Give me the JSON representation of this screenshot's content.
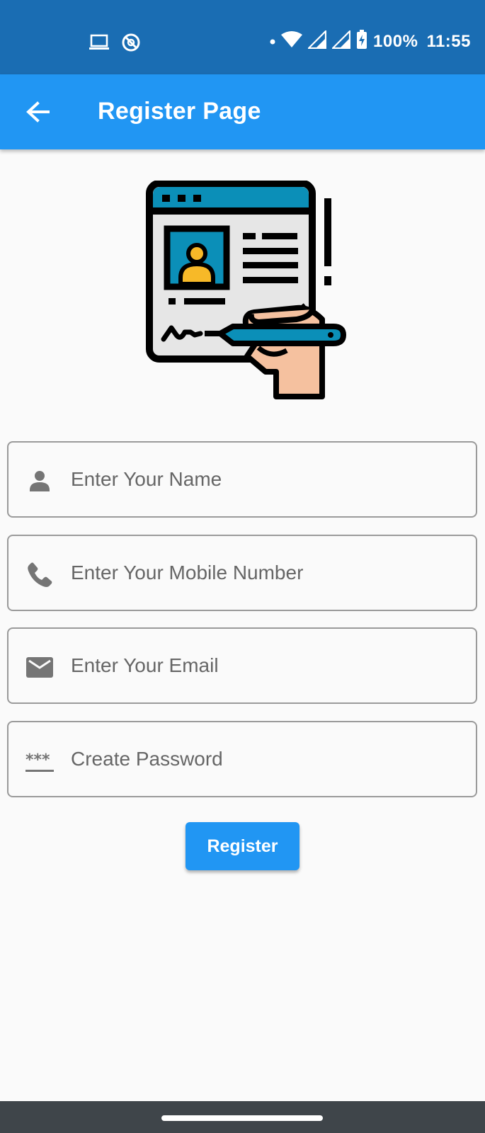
{
  "status_bar": {
    "battery": "100%",
    "time": "11:55",
    "icons": [
      "laptop-icon",
      "sync-off-icon",
      "dot-icon",
      "wifi-icon",
      "signal-icon",
      "signal-icon",
      "battery-charging-icon"
    ]
  },
  "app_bar": {
    "title": "Register Page",
    "back_icon": "arrow-back-icon",
    "background": "#2196f3"
  },
  "form": {
    "name": {
      "placeholder": "Enter Your Name",
      "value": "",
      "icon": "person-icon"
    },
    "mobile": {
      "placeholder": "Enter Your Mobile Number",
      "value": "",
      "icon": "phone-icon"
    },
    "email": {
      "placeholder": "Enter Your Email",
      "value": "",
      "icon": "email-icon"
    },
    "password": {
      "placeholder": "Create Password",
      "value": "",
      "icon": "password-icon"
    },
    "submit_label": "Register"
  },
  "colors": {
    "status_bar": "#1a6db3",
    "accent": "#2196f3",
    "nav_bar": "#3f454a"
  }
}
